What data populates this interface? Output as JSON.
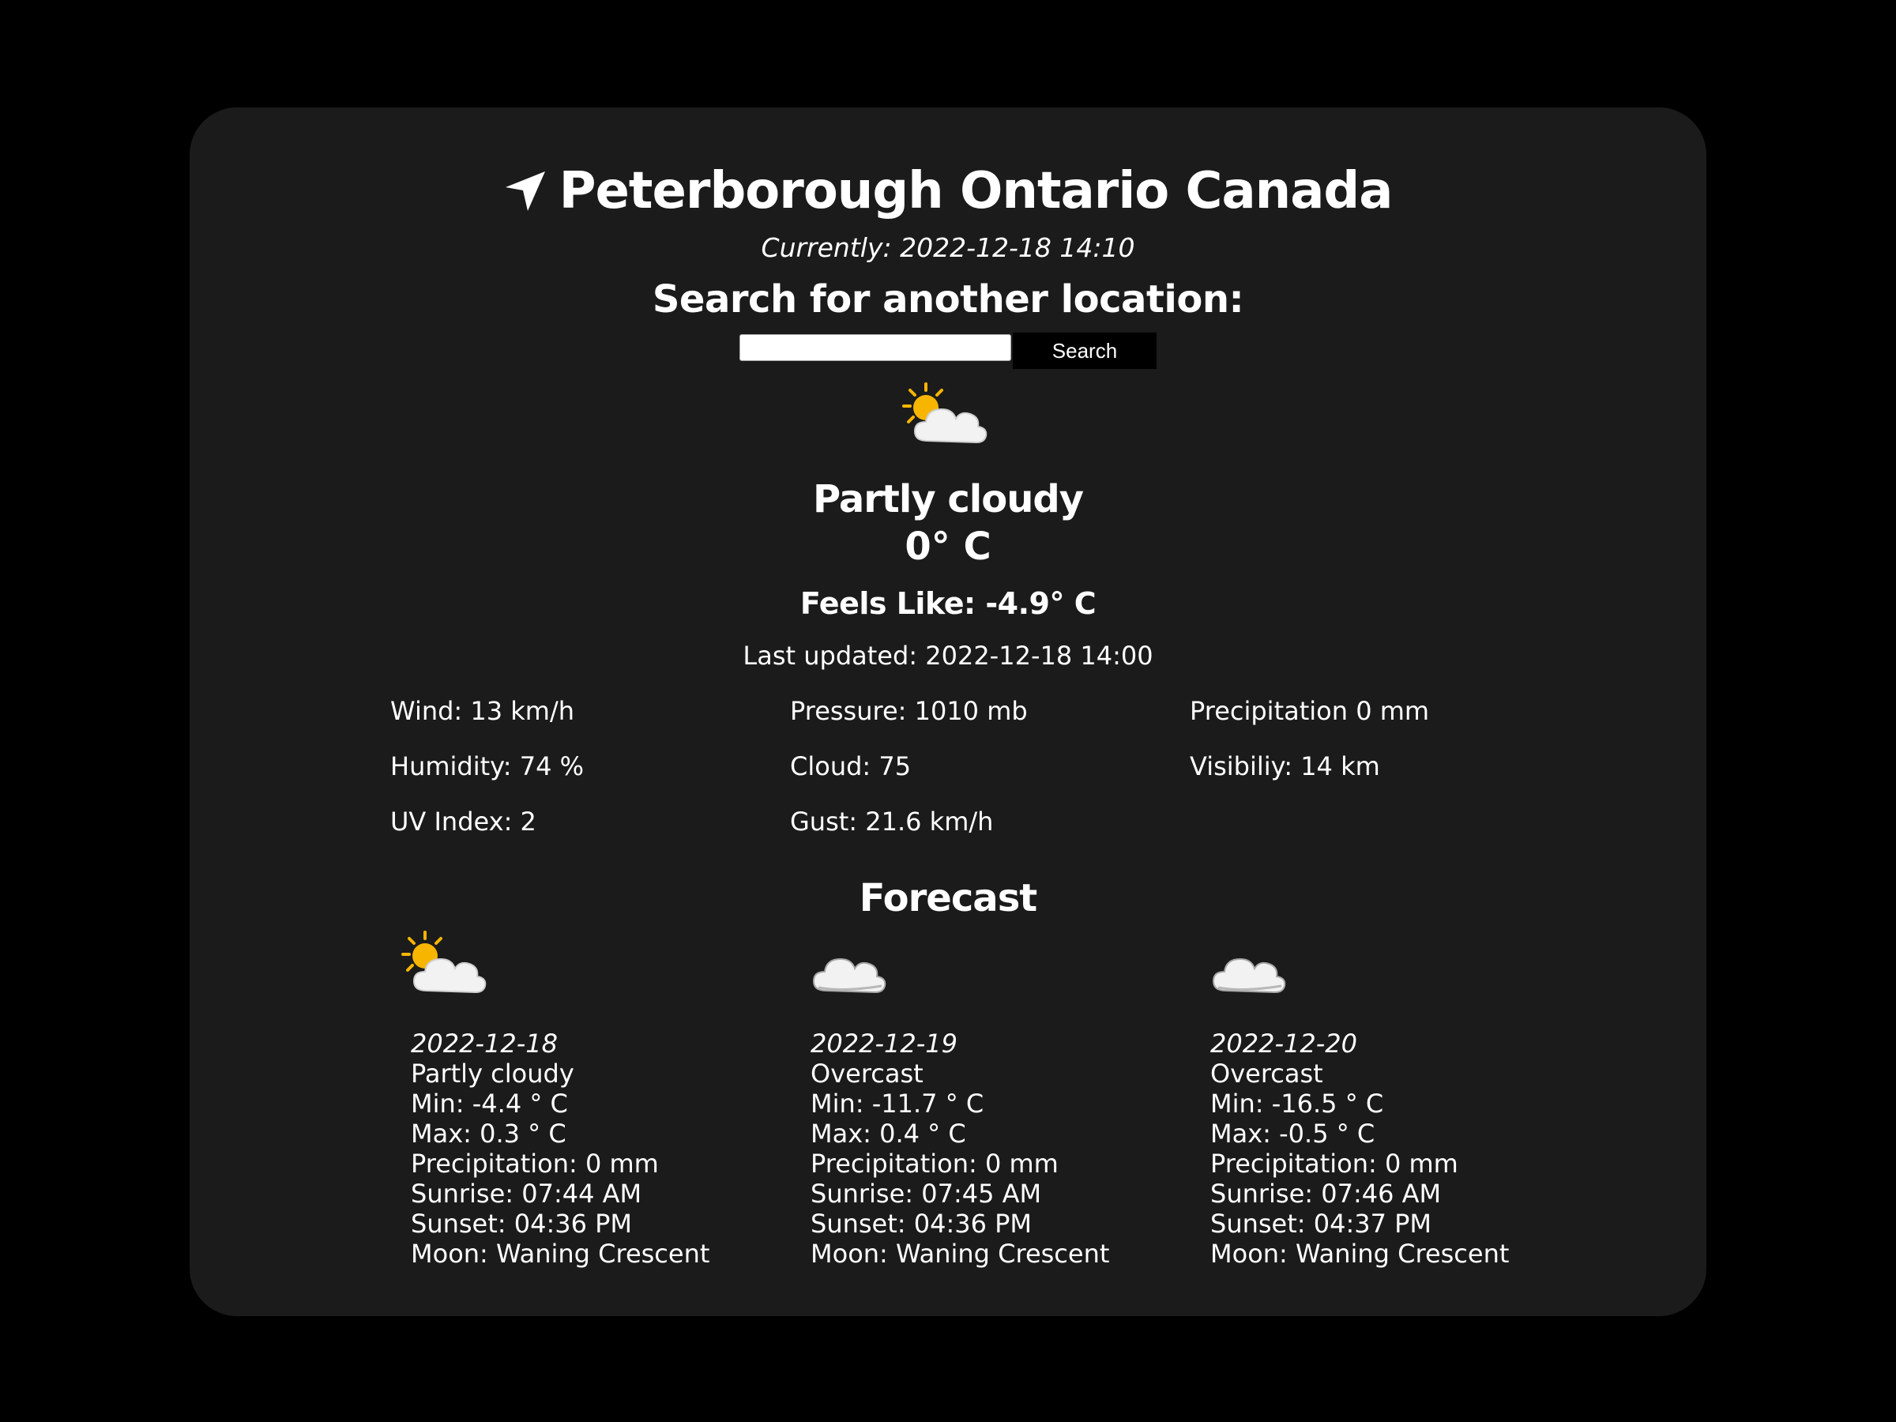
{
  "location": {
    "title": "Peterborough Ontario Canada",
    "icon": "location-arrow-icon"
  },
  "current": {
    "currently_text": "Currently: 2022-12-18 14:10",
    "search_heading": "Search for another location:",
    "search_value": "",
    "search_button": "Search",
    "condition": "Partly cloudy",
    "condition_icon": "partly-cloudy-icon",
    "temperature": "0° C",
    "feels_like": "Feels Like: -4.9° C",
    "last_updated": "Last updated: 2022-12-18 14:00"
  },
  "stats": {
    "wind": "Wind: 13 km/h",
    "pressure": "Pressure: 1010 mb",
    "precipitation": "Precipitation 0 mm",
    "humidity": "Humidity: 74 %",
    "cloud": "Cloud: 75",
    "visibility": "Visibiliy: 14 km",
    "uv": "UV Index: 2",
    "gust": "Gust: 21.6 km/h"
  },
  "forecast": {
    "heading": "Forecast",
    "days": [
      {
        "icon": "partly-cloudy-icon",
        "date": "2022-12-18",
        "condition": "Partly cloudy",
        "min": "Min: -4.4 ° C",
        "max": "Max: 0.3 ° C",
        "precipitation": "Precipitation: 0 mm",
        "sunrise": "Sunrise: 07:44 AM",
        "sunset": "Sunset: 04:36 PM",
        "moon": "Moon: Waning Crescent"
      },
      {
        "icon": "cloud-icon",
        "date": "2022-12-19",
        "condition": "Overcast",
        "min": "Min: -11.7 ° C",
        "max": "Max: 0.4 ° C",
        "precipitation": "Precipitation: 0 mm",
        "sunrise": "Sunrise: 07:45 AM",
        "sunset": "Sunset: 04:36 PM",
        "moon": "Moon: Waning Crescent"
      },
      {
        "icon": "cloud-icon",
        "date": "2022-12-20",
        "condition": "Overcast",
        "min": "Min: -16.5 ° C",
        "max": "Max: -0.5 ° C",
        "precipitation": "Precipitation: 0 mm",
        "sunrise": "Sunrise: 07:46 AM",
        "sunset": "Sunset: 04:37 PM",
        "moon": "Moon: Waning Crescent"
      }
    ]
  },
  "colors": {
    "page_background": "#000000",
    "card_background": "#1b1b1b",
    "text": "#ffffff",
    "sun": "#f7b500",
    "cloud": "#f2f2f2"
  }
}
